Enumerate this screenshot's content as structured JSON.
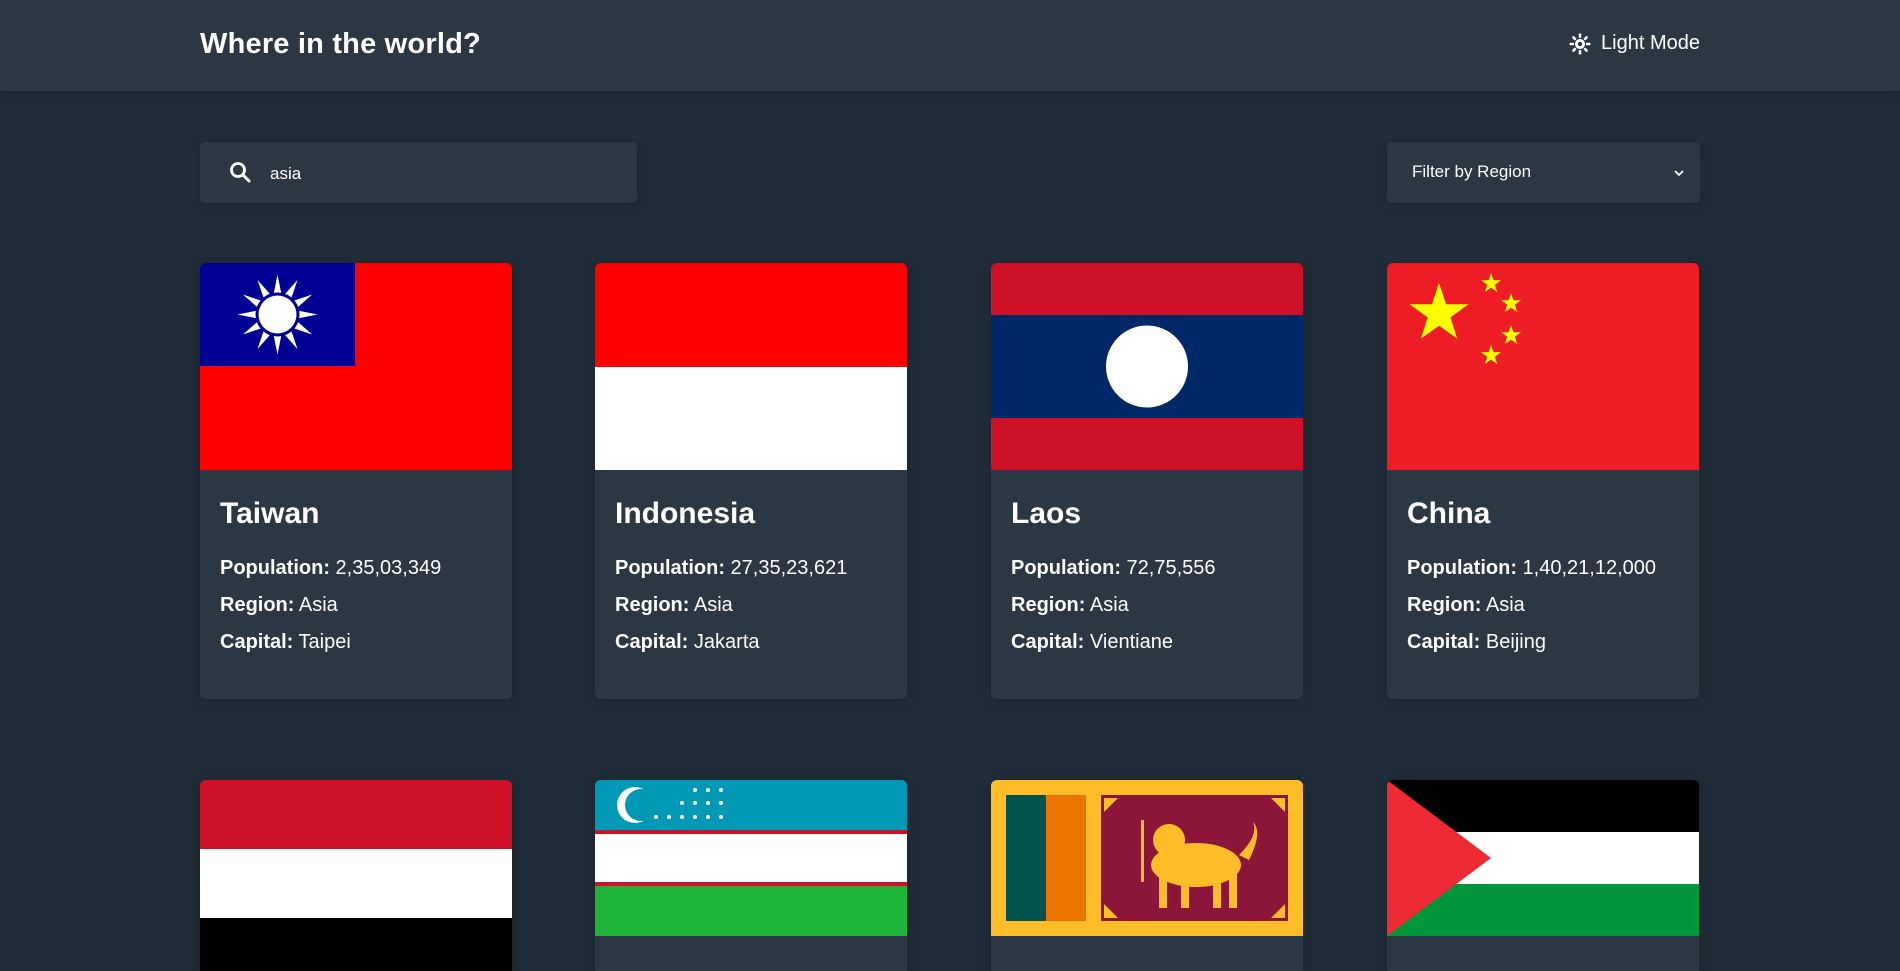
{
  "header": {
    "title": "Where in the world?",
    "mode_label": "Light Mode",
    "mode_icon": "sun-icon"
  },
  "search": {
    "value": "asia",
    "icon": "search-icon"
  },
  "filter": {
    "selected": "Filter by Region",
    "icon": "chevron-down-icon"
  },
  "labels": {
    "population": "Population:",
    "region": "Region:",
    "capital": "Capital:"
  },
  "countries": [
    {
      "name": "Taiwan",
      "population": "2,35,03,349",
      "region": "Asia",
      "capital": "Taipei"
    },
    {
      "name": "Indonesia",
      "population": "27,35,23,621",
      "region": "Asia",
      "capital": "Jakarta"
    },
    {
      "name": "Laos",
      "population": "72,75,556",
      "region": "Asia",
      "capital": "Vientiane"
    },
    {
      "name": "China",
      "population": "1,40,21,12,000",
      "region": "Asia",
      "capital": "Beijing"
    }
  ],
  "partial_flags": [
    "yemen-flag",
    "uzbekistan-flag",
    "sri-lanka-flag",
    "palestine-flag"
  ],
  "colors": {
    "background": "#202c37",
    "surface": "#2b3743",
    "text": "#ffffff"
  }
}
